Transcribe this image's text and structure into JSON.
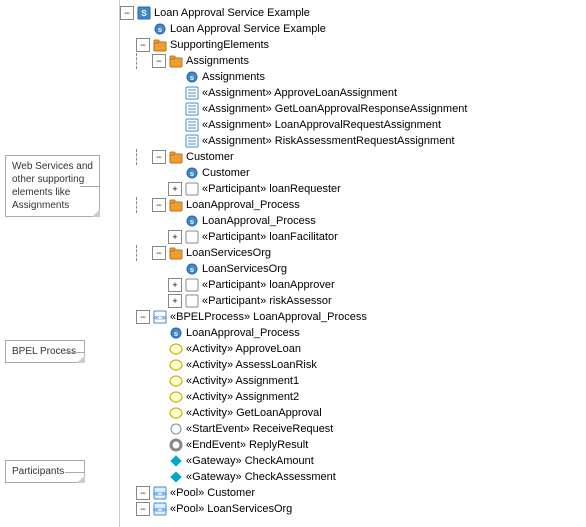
{
  "title": "Loan Approval Service Example",
  "annotations": {
    "web_services": "Web Services and other supporting elements like Assignments",
    "bpel": "BPEL Process",
    "participants": "Participants"
  },
  "tree": [
    {
      "id": "root",
      "label": "Loan Approval Service Example",
      "type": "service",
      "level": 0,
      "expanded": true
    },
    {
      "id": "loan-svc",
      "label": "Loan Approval Service Example",
      "type": "service2",
      "level": 1,
      "expanded": false
    },
    {
      "id": "supporting",
      "label": "SupportingElements",
      "type": "folder",
      "level": 1,
      "expanded": true
    },
    {
      "id": "assignments-folder",
      "label": "Assignments",
      "type": "folder",
      "level": 2,
      "expanded": true
    },
    {
      "id": "assignments-item",
      "label": "Assignments",
      "type": "service2",
      "level": 3,
      "expanded": false
    },
    {
      "id": "approve",
      "label": "«Assignment» ApproveLoanAssignment",
      "type": "list",
      "level": 3,
      "expanded": false
    },
    {
      "id": "getloan",
      "label": "«Assignment» GetLoanApprovalResponseAssignment",
      "type": "list",
      "level": 3,
      "expanded": false
    },
    {
      "id": "loanreq",
      "label": "«Assignment» LoanApprovalRequestAssignment",
      "type": "list",
      "level": 3,
      "expanded": false
    },
    {
      "id": "riskassess",
      "label": "«Assignment» RiskAssessmentRequestAssignment",
      "type": "list",
      "level": 3,
      "expanded": false
    },
    {
      "id": "customer-folder",
      "label": "Customer",
      "type": "folder",
      "level": 2,
      "expanded": true
    },
    {
      "id": "customer-item",
      "label": "Customer",
      "type": "service2",
      "level": 3,
      "expanded": false
    },
    {
      "id": "loanrequester",
      "label": "«Participant» loanRequester",
      "type": "expand-item",
      "level": 3,
      "expanded": false
    },
    {
      "id": "loanapproval-folder",
      "label": "LoanApproval_Process",
      "type": "folder",
      "level": 2,
      "expanded": true
    },
    {
      "id": "loanapproval-item",
      "label": "LoanApproval_Process",
      "type": "service2",
      "level": 3,
      "expanded": false
    },
    {
      "id": "loanfacilitator",
      "label": "«Participant» loanFacilitator",
      "type": "expand-item",
      "level": 3,
      "expanded": false
    },
    {
      "id": "loanservices-folder",
      "label": "LoanServicesOrg",
      "type": "folder",
      "level": 2,
      "expanded": true
    },
    {
      "id": "loanservices-item",
      "label": "LoanServicesOrg",
      "type": "service2",
      "level": 3,
      "expanded": false
    },
    {
      "id": "loanapprover",
      "label": "«Participant» loanApprover",
      "type": "expand-item",
      "level": 3,
      "expanded": false
    },
    {
      "id": "riskassessor",
      "label": "«Participant» riskAssessor",
      "type": "expand-item",
      "level": 3,
      "expanded": false
    },
    {
      "id": "bpelprocess",
      "label": "«BPELProcess» LoanApproval_Process",
      "type": "expand-bpel",
      "level": 1,
      "expanded": true
    },
    {
      "id": "loanapproval-proc",
      "label": "LoanApproval_Process",
      "type": "service2",
      "level": 2,
      "expanded": false
    },
    {
      "id": "approveloan",
      "label": "«Activity» ApproveLoan",
      "type": "activity",
      "level": 2,
      "expanded": false
    },
    {
      "id": "assessloanrisk",
      "label": "«Activity» AssessLoanRisk",
      "type": "activity",
      "level": 2,
      "expanded": false
    },
    {
      "id": "assignment1",
      "label": "«Activity» Assignment1",
      "type": "activity",
      "level": 2,
      "expanded": false
    },
    {
      "id": "assignment2",
      "label": "«Activity» Assignment2",
      "type": "activity",
      "level": 2,
      "expanded": false
    },
    {
      "id": "getloanapproval",
      "label": "«Activity» GetLoanApproval",
      "type": "activity",
      "level": 2,
      "expanded": false
    },
    {
      "id": "receiverequest",
      "label": "«StartEvent» ReceiveRequest",
      "type": "start-event",
      "level": 2,
      "expanded": false
    },
    {
      "id": "replyresult",
      "label": "«EndEvent» ReplyResult",
      "type": "end-event",
      "level": 2,
      "expanded": false
    },
    {
      "id": "checkamount",
      "label": "«Gateway» CheckAmount",
      "type": "gateway",
      "level": 2,
      "expanded": false
    },
    {
      "id": "checkassessment",
      "label": "«Gateway» CheckAssessment",
      "type": "gateway",
      "level": 2,
      "expanded": false
    },
    {
      "id": "pool-customer",
      "label": "«Pool» Customer",
      "type": "pool",
      "level": 1,
      "expanded": false
    },
    {
      "id": "pool-loanservices",
      "label": "«Pool» LoanServicesOrg",
      "type": "pool",
      "level": 1,
      "expanded": false
    }
  ]
}
